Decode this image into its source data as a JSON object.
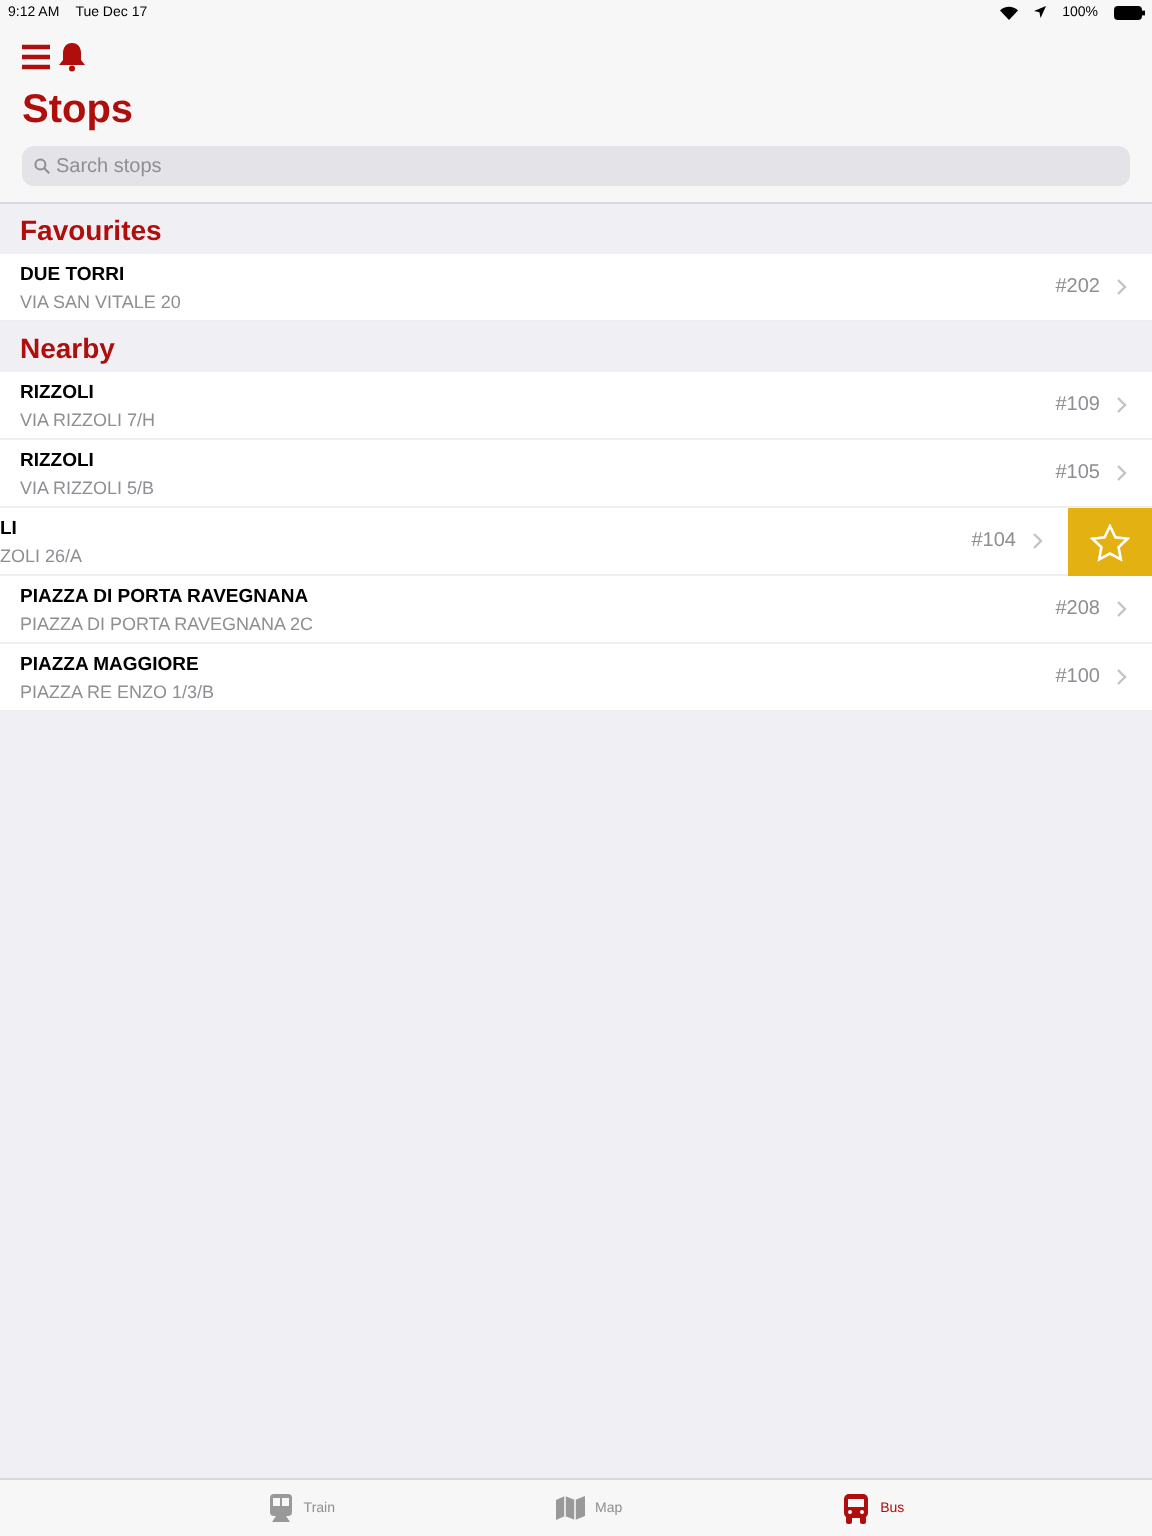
{
  "status_bar": {
    "time": "9:12 AM",
    "date": "Tue Dec 17",
    "battery": "100%"
  },
  "title": "Stops",
  "search": {
    "placeholder": "Sarch stops"
  },
  "sections": [
    {
      "title": "Favourites",
      "rows": [
        {
          "name": "DUE TORRI",
          "address": "VIA SAN VITALE 20",
          "number": "#202",
          "swiped": false
        }
      ]
    },
    {
      "title": "Nearby",
      "rows": [
        {
          "name": "RIZZOLI",
          "address": "VIA RIZZOLI 7/H",
          "number": "#109",
          "swiped": false
        },
        {
          "name": "RIZZOLI",
          "address": "VIA RIZZOLI 5/B",
          "number": "#105",
          "swiped": false
        },
        {
          "name": "LI",
          "address": "ZOLI 26/A",
          "number": "#104",
          "swiped": true
        },
        {
          "name": "PIAZZA DI PORTA RAVEGNANA",
          "address": "PIAZZA DI PORTA RAVEGNANA 2C",
          "number": "#208",
          "swiped": false
        },
        {
          "name": "PIAZZA MAGGIORE",
          "address": "PIAZZA RE ENZO 1/3/B",
          "number": "#100",
          "swiped": false
        }
      ]
    }
  ],
  "tabs": [
    {
      "label": "Train",
      "kind": "train",
      "selected": false
    },
    {
      "label": "Map",
      "kind": "map",
      "selected": false
    },
    {
      "label": "Bus",
      "kind": "bus",
      "selected": true
    }
  ]
}
